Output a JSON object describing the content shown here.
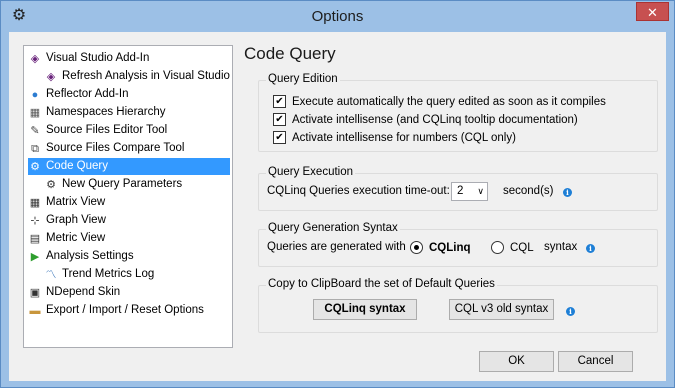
{
  "window": {
    "title": "Options",
    "close_glyph": "✕",
    "settings_glyph": "⚙"
  },
  "tree": {
    "items": [
      {
        "label": "Visual Studio Add-In",
        "icon": "vs-icon",
        "glyph": "◈",
        "color": "#68217a",
        "indent": 0
      },
      {
        "label": "Refresh Analysis in Visual Studio",
        "icon": "vs-refresh-icon",
        "glyph": "◈",
        "color": "#68217a",
        "indent": 1
      },
      {
        "label": "Reflector Add-In",
        "icon": "reflector-icon",
        "glyph": "●",
        "color": "#2c7cd1",
        "indent": 0
      },
      {
        "label": "Namespaces Hierarchy",
        "icon": "namespace-icon",
        "glyph": "▦",
        "color": "#555555",
        "indent": 0
      },
      {
        "label": "Source Files Editor Tool",
        "icon": "editor-icon",
        "glyph": "✎",
        "color": "#444444",
        "indent": 0
      },
      {
        "label": "Source Files Compare Tool",
        "icon": "compare-icon",
        "glyph": "⧉",
        "color": "#444444",
        "indent": 0
      },
      {
        "label": "Code Query",
        "icon": "gear-icon",
        "glyph": "⚙",
        "color": "#333333",
        "indent": 0,
        "selected": true
      },
      {
        "label": "New Query Parameters",
        "icon": "gear-icon",
        "glyph": "⚙",
        "color": "#333333",
        "indent": 1
      },
      {
        "label": "Matrix View",
        "icon": "matrix-icon",
        "glyph": "▦",
        "color": "#333333",
        "indent": 0
      },
      {
        "label": "Graph View",
        "icon": "graph-icon",
        "glyph": "⊹",
        "color": "#333333",
        "indent": 0
      },
      {
        "label": "Metric View",
        "icon": "metric-icon",
        "glyph": "▤",
        "color": "#333333",
        "indent": 0
      },
      {
        "label": "Analysis Settings",
        "icon": "play-icon",
        "glyph": "▶",
        "color": "#2e9e2e",
        "indent": 0
      },
      {
        "label": "Trend Metrics Log",
        "icon": "trend-icon",
        "glyph": "〽",
        "color": "#2c6cb5",
        "indent": 1
      },
      {
        "label": "NDepend Skin",
        "icon": "skin-icon",
        "glyph": "▣",
        "color": "#333333",
        "indent": 0
      },
      {
        "label": "Export / Import / Reset Options",
        "icon": "folder-icon",
        "glyph": "▬",
        "color": "#c8963c",
        "indent": 0
      }
    ]
  },
  "panel": {
    "title": "Code Query",
    "edition": {
      "label": "Query Edition",
      "options": [
        {
          "label": "Execute automatically the query edited as soon as it compiles",
          "checked": true
        },
        {
          "label": "Activate intellisense (and CQLinq tooltip documentation)",
          "checked": true
        },
        {
          "label": "Activate intellisense for numbers (CQL only)",
          "checked": true
        }
      ]
    },
    "execution": {
      "label": "Query Execution",
      "timeout_label": "CQLinq Queries execution time-out:",
      "timeout_value": "2",
      "unit": "second(s)"
    },
    "syntax": {
      "label": "Query Generation Syntax",
      "prefix": "Queries are generated with",
      "opt1": "CQLinq",
      "opt2": "CQL",
      "suffix": "syntax"
    },
    "clipboard": {
      "label": "Copy to ClipBoard the set of Default Queries",
      "btn1": "CQLinq syntax",
      "btn2": "CQL v3 old syntax"
    }
  },
  "footer": {
    "ok": "OK",
    "cancel": "Cancel"
  },
  "check_glyph": "✔",
  "arrow_glyph": "∨",
  "info_glyph": "i"
}
